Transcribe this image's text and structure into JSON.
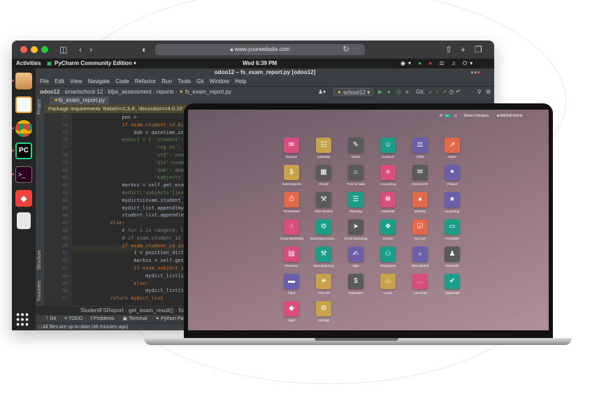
{
  "browser": {
    "url": "www.yourwebsite.com"
  },
  "desktop": {
    "activities": "Activities",
    "app_name": "PyCharm Community Edition ▾",
    "clock": "Wed  6:39 PM"
  },
  "pycharm": {
    "window_title": "odoo12 – fs_exam_report.py [odoo12]",
    "menu": [
      "File",
      "Edit",
      "View",
      "Navigate",
      "Code",
      "Refactor",
      "Run",
      "Tools",
      "Git",
      "Window",
      "Help"
    ],
    "breadcrumb": [
      "odoo12",
      "smartschool-12",
      "bfps_assessment",
      "reports",
      "fs_exam_report.py"
    ],
    "run_config": "school12",
    "git_label": "Git:",
    "editor_tab": "fs_exam_report.py",
    "warning": "Package requirements 'Babel==2.3.4', 'decorator==4.0.10'",
    "line_numbers": [
      "73",
      "74",
      "75",
      "76",
      "77",
      "78",
      "79",
      "80",
      "81",
      "82",
      "83",
      "84",
      "85",
      "86",
      "87",
      "88",
      "89",
      "90",
      "91",
      "92",
      "93",
      "94",
      "95",
      "96",
      "97"
    ],
    "code_lines": [
      "                pos = ",
      "                if exam.student_id.birth_",
      "                    dob = datetime.strptl",
      "                mydict = { 'student': exam",
      "                           'reg_no': exam.",
      "                           'std': exam.sta",
      "                           'div':exam.div",
      "                           'dob': dob if s",
      "                           'subjects': {e",
      "                markss = self.get_exam_ma",
      "                mydict['subjects'][exam.st",
      "                mydicts[exam.student_id].",
      "                mydict_list.append(mydict",
      "                student_list.append(exam.",
      "            else:",
      "                # for i in range(0, len(",
      "                # if exam.student_id in s",
      "                if exam.student_id in posit",
      "                    i = position_dict[exa",
      "                    markss = self.get_exa",
      "                    if exam.subject_id.na",
      "                        mydict_list[i][ex",
      "                    else:",
      "                        mydict_list[i][ex",
      "            return mydict_list"
    ],
    "code_crumb": [
      "StudentFSReport",
      "get_exam_result()",
      "for ex"
    ],
    "side_labels": [
      "Project",
      "Structure",
      "Favorites"
    ],
    "bottom_tabs": [
      "Git",
      "TODO",
      "Problems",
      "Terminal",
      "Python Pac"
    ],
    "status": "All files are up-to-date (46 minutes ago)"
  },
  "odoo": {
    "top_badge": "99+",
    "company": "Demo Company",
    "user": "Mitchell Admin",
    "apps": [
      {
        "label": "Discuss",
        "icon": "chat-icon",
        "glyph": "✉",
        "color": "#d84f7f"
      },
      {
        "label": "Calendar",
        "icon": "calendar-icon",
        "glyph": "☷",
        "color": "#c9a34a"
      },
      {
        "label": "Notes",
        "icon": "notes-icon",
        "glyph": "✎",
        "color": "#5a5a5a"
      },
      {
        "label": "Contacts",
        "icon": "contacts-icon",
        "glyph": "☺",
        "color": "#1a9e8a"
      },
      {
        "label": "CRM",
        "icon": "handshake-icon",
        "glyph": "⚖",
        "color": "#6a5fa8"
      },
      {
        "label": "Sales",
        "icon": "sales-chart-icon",
        "glyph": "↗",
        "color": "#e26a4b"
      },
      {
        "label": "Subscriptions",
        "icon": "subscriptions-icon",
        "glyph": "$",
        "color": "#c9a34a"
      },
      {
        "label": "Rental",
        "icon": "rental-icon",
        "glyph": "▦",
        "color": "#5a5a5a"
      },
      {
        "label": "Point of Sale",
        "icon": "store-icon",
        "glyph": "⌂",
        "color": "#5a5a5a"
      },
      {
        "label": "Accounting",
        "icon": "accounting-icon",
        "glyph": "≡",
        "color": "#d84f7f"
      },
      {
        "label": "Documents",
        "icon": "documents-icon",
        "glyph": "✉",
        "color": "#5a5a5a"
      },
      {
        "label": "Project",
        "icon": "puzzle-icon",
        "glyph": "✦",
        "color": "#6a5fa8"
      },
      {
        "label": "Timesheets",
        "icon": "stopwatch-icon",
        "glyph": "⏱",
        "color": "#e26a4b"
      },
      {
        "label": "Field Service",
        "icon": "field-service-icon",
        "glyph": "⚒",
        "color": "#5a5a5a"
      },
      {
        "label": "Planning",
        "icon": "planning-icon",
        "glyph": "☰",
        "color": "#1a9e8a"
      },
      {
        "label": "Helpdesk",
        "icon": "lifebuoy-icon",
        "glyph": "☸",
        "color": "#d84f7f"
      },
      {
        "label": "Website",
        "icon": "globe-icon",
        "glyph": "●",
        "color": "#e26a4b"
      },
      {
        "label": "eLearning",
        "icon": "elearning-icon",
        "glyph": "★",
        "color": "#6a5fa8"
      },
      {
        "label": "Social Marketing",
        "icon": "thumbs-up-icon",
        "glyph": "☝",
        "color": "#d84f7f"
      },
      {
        "label": "Marketing Autom...",
        "icon": "gear-icon",
        "glyph": "⚙",
        "color": "#1a9e8a"
      },
      {
        "label": "Email Marketing",
        "icon": "paper-plane-icon",
        "glyph": "➤",
        "color": "#5a5a5a"
      },
      {
        "label": "Events",
        "icon": "ticket-icon",
        "glyph": "❖",
        "color": "#1a9e8a"
      },
      {
        "label": "Surveys",
        "icon": "surveys-icon",
        "glyph": "☑",
        "color": "#e26a4b"
      },
      {
        "label": "Purchase",
        "icon": "credit-card-icon",
        "glyph": "▭",
        "color": "#1a9e8a"
      },
      {
        "label": "Inventory",
        "icon": "boxes-icon",
        "glyph": "▤",
        "color": "#d84f7f"
      },
      {
        "label": "Manufacturing",
        "icon": "wrench-icon",
        "glyph": "⚒",
        "color": "#1a9e8a"
      },
      {
        "label": "Sign",
        "icon": "sign-icon",
        "glyph": "✍",
        "color": "#6a5fa8"
      },
      {
        "label": "Employees",
        "icon": "employees-icon",
        "glyph": "⚇",
        "color": "#1a9e8a"
      },
      {
        "label": "Recruitment",
        "icon": "magnifier-icon",
        "glyph": "⌕",
        "color": "#6a5fa8"
      },
      {
        "label": "Referrals",
        "icon": "referrals-icon",
        "glyph": "♟",
        "color": "#5a5a5a"
      },
      {
        "label": "Fleet",
        "icon": "car-icon",
        "glyph": "▬",
        "color": "#6a5fa8"
      },
      {
        "label": "Time Off",
        "icon": "time-off-icon",
        "glyph": "☀",
        "color": "#c9a34a"
      },
      {
        "label": "Expenses",
        "icon": "expenses-icon",
        "glyph": "$",
        "color": "#5a5a5a"
      },
      {
        "label": "Lunch",
        "icon": "fork-knife-icon",
        "glyph": "♨",
        "color": "#c9a34a"
      },
      {
        "label": "Live Chat",
        "icon": "speech-bubble-icon",
        "glyph": "…",
        "color": "#d84f7f"
      },
      {
        "label": "Approvals",
        "icon": "approvals-icon",
        "glyph": "✔",
        "color": "#1a9e8a"
      },
      {
        "label": "Apps",
        "icon": "apps-icon",
        "glyph": "◆",
        "color": "#d84f7f"
      },
      {
        "label": "Settings",
        "icon": "settings-gear-icon",
        "glyph": "⚙",
        "color": "#c9a34a"
      }
    ]
  }
}
